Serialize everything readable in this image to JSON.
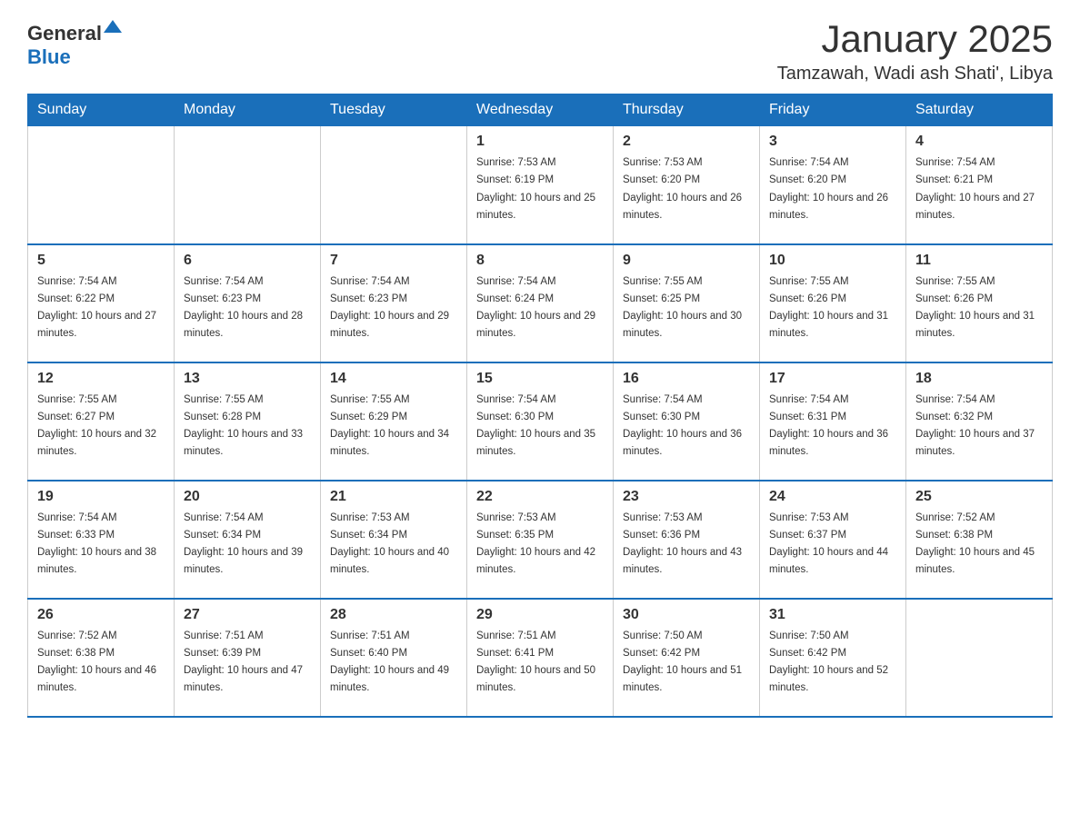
{
  "header": {
    "logo_general": "General",
    "logo_blue": "Blue",
    "title": "January 2025",
    "subtitle": "Tamzawah, Wadi ash Shati', Libya"
  },
  "weekdays": [
    "Sunday",
    "Monday",
    "Tuesday",
    "Wednesday",
    "Thursday",
    "Friday",
    "Saturday"
  ],
  "weeks": [
    [
      {
        "day": "",
        "sunrise": "",
        "sunset": "",
        "daylight": ""
      },
      {
        "day": "",
        "sunrise": "",
        "sunset": "",
        "daylight": ""
      },
      {
        "day": "",
        "sunrise": "",
        "sunset": "",
        "daylight": ""
      },
      {
        "day": "1",
        "sunrise": "Sunrise: 7:53 AM",
        "sunset": "Sunset: 6:19 PM",
        "daylight": "Daylight: 10 hours and 25 minutes."
      },
      {
        "day": "2",
        "sunrise": "Sunrise: 7:53 AM",
        "sunset": "Sunset: 6:20 PM",
        "daylight": "Daylight: 10 hours and 26 minutes."
      },
      {
        "day": "3",
        "sunrise": "Sunrise: 7:54 AM",
        "sunset": "Sunset: 6:20 PM",
        "daylight": "Daylight: 10 hours and 26 minutes."
      },
      {
        "day": "4",
        "sunrise": "Sunrise: 7:54 AM",
        "sunset": "Sunset: 6:21 PM",
        "daylight": "Daylight: 10 hours and 27 minutes."
      }
    ],
    [
      {
        "day": "5",
        "sunrise": "Sunrise: 7:54 AM",
        "sunset": "Sunset: 6:22 PM",
        "daylight": "Daylight: 10 hours and 27 minutes."
      },
      {
        "day": "6",
        "sunrise": "Sunrise: 7:54 AM",
        "sunset": "Sunset: 6:23 PM",
        "daylight": "Daylight: 10 hours and 28 minutes."
      },
      {
        "day": "7",
        "sunrise": "Sunrise: 7:54 AM",
        "sunset": "Sunset: 6:23 PM",
        "daylight": "Daylight: 10 hours and 29 minutes."
      },
      {
        "day": "8",
        "sunrise": "Sunrise: 7:54 AM",
        "sunset": "Sunset: 6:24 PM",
        "daylight": "Daylight: 10 hours and 29 minutes."
      },
      {
        "day": "9",
        "sunrise": "Sunrise: 7:55 AM",
        "sunset": "Sunset: 6:25 PM",
        "daylight": "Daylight: 10 hours and 30 minutes."
      },
      {
        "day": "10",
        "sunrise": "Sunrise: 7:55 AM",
        "sunset": "Sunset: 6:26 PM",
        "daylight": "Daylight: 10 hours and 31 minutes."
      },
      {
        "day": "11",
        "sunrise": "Sunrise: 7:55 AM",
        "sunset": "Sunset: 6:26 PM",
        "daylight": "Daylight: 10 hours and 31 minutes."
      }
    ],
    [
      {
        "day": "12",
        "sunrise": "Sunrise: 7:55 AM",
        "sunset": "Sunset: 6:27 PM",
        "daylight": "Daylight: 10 hours and 32 minutes."
      },
      {
        "day": "13",
        "sunrise": "Sunrise: 7:55 AM",
        "sunset": "Sunset: 6:28 PM",
        "daylight": "Daylight: 10 hours and 33 minutes."
      },
      {
        "day": "14",
        "sunrise": "Sunrise: 7:55 AM",
        "sunset": "Sunset: 6:29 PM",
        "daylight": "Daylight: 10 hours and 34 minutes."
      },
      {
        "day": "15",
        "sunrise": "Sunrise: 7:54 AM",
        "sunset": "Sunset: 6:30 PM",
        "daylight": "Daylight: 10 hours and 35 minutes."
      },
      {
        "day": "16",
        "sunrise": "Sunrise: 7:54 AM",
        "sunset": "Sunset: 6:30 PM",
        "daylight": "Daylight: 10 hours and 36 minutes."
      },
      {
        "day": "17",
        "sunrise": "Sunrise: 7:54 AM",
        "sunset": "Sunset: 6:31 PM",
        "daylight": "Daylight: 10 hours and 36 minutes."
      },
      {
        "day": "18",
        "sunrise": "Sunrise: 7:54 AM",
        "sunset": "Sunset: 6:32 PM",
        "daylight": "Daylight: 10 hours and 37 minutes."
      }
    ],
    [
      {
        "day": "19",
        "sunrise": "Sunrise: 7:54 AM",
        "sunset": "Sunset: 6:33 PM",
        "daylight": "Daylight: 10 hours and 38 minutes."
      },
      {
        "day": "20",
        "sunrise": "Sunrise: 7:54 AM",
        "sunset": "Sunset: 6:34 PM",
        "daylight": "Daylight: 10 hours and 39 minutes."
      },
      {
        "day": "21",
        "sunrise": "Sunrise: 7:53 AM",
        "sunset": "Sunset: 6:34 PM",
        "daylight": "Daylight: 10 hours and 40 minutes."
      },
      {
        "day": "22",
        "sunrise": "Sunrise: 7:53 AM",
        "sunset": "Sunset: 6:35 PM",
        "daylight": "Daylight: 10 hours and 42 minutes."
      },
      {
        "day": "23",
        "sunrise": "Sunrise: 7:53 AM",
        "sunset": "Sunset: 6:36 PM",
        "daylight": "Daylight: 10 hours and 43 minutes."
      },
      {
        "day": "24",
        "sunrise": "Sunrise: 7:53 AM",
        "sunset": "Sunset: 6:37 PM",
        "daylight": "Daylight: 10 hours and 44 minutes."
      },
      {
        "day": "25",
        "sunrise": "Sunrise: 7:52 AM",
        "sunset": "Sunset: 6:38 PM",
        "daylight": "Daylight: 10 hours and 45 minutes."
      }
    ],
    [
      {
        "day": "26",
        "sunrise": "Sunrise: 7:52 AM",
        "sunset": "Sunset: 6:38 PM",
        "daylight": "Daylight: 10 hours and 46 minutes."
      },
      {
        "day": "27",
        "sunrise": "Sunrise: 7:51 AM",
        "sunset": "Sunset: 6:39 PM",
        "daylight": "Daylight: 10 hours and 47 minutes."
      },
      {
        "day": "28",
        "sunrise": "Sunrise: 7:51 AM",
        "sunset": "Sunset: 6:40 PM",
        "daylight": "Daylight: 10 hours and 49 minutes."
      },
      {
        "day": "29",
        "sunrise": "Sunrise: 7:51 AM",
        "sunset": "Sunset: 6:41 PM",
        "daylight": "Daylight: 10 hours and 50 minutes."
      },
      {
        "day": "30",
        "sunrise": "Sunrise: 7:50 AM",
        "sunset": "Sunset: 6:42 PM",
        "daylight": "Daylight: 10 hours and 51 minutes."
      },
      {
        "day": "31",
        "sunrise": "Sunrise: 7:50 AM",
        "sunset": "Sunset: 6:42 PM",
        "daylight": "Daylight: 10 hours and 52 minutes."
      },
      {
        "day": "",
        "sunrise": "",
        "sunset": "",
        "daylight": ""
      }
    ]
  ]
}
